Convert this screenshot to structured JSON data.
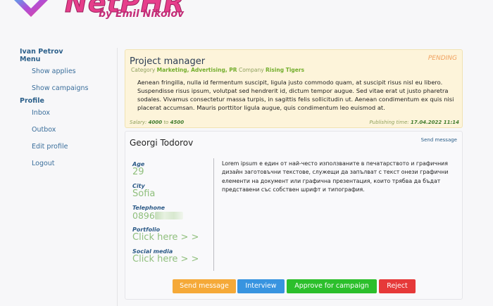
{
  "logo": {
    "text": "NetPHR",
    "subtitle": "by Emil Nikolov"
  },
  "sidebar": {
    "user": "Ivan Petrov",
    "menu_heading": "Menu",
    "menu_items": [
      "Show applies",
      "Show campaigns"
    ],
    "profile_heading": "Profile",
    "profile_items": [
      "Inbox",
      "Outbox",
      "Edit profile",
      "Logout"
    ]
  },
  "job": {
    "title": "Project manager",
    "status": "PENDING",
    "category_label": "Category",
    "categories": "Marketing, Advertising, PR",
    "company_label": "Company",
    "company": "Rising Tigers",
    "description": "Aenean fringilla, nulla id fermentum suscipit, ligula justo commodo quam, at suscipit risus nisl eu libero. Suspendisse risus ipsum, volutpat sed hendrerit id, dictum tempor augue. Sed vitae erat ut justo pharetra sodales. Vivamus consectetur massa turpis, in sagittis felis sollicitudin ut. Aenean condimentum ex quis nisi placerat accumsan. Mauris porttitor ligula augue, quis condimentum leo euismod at.",
    "salary_label": "Salary:",
    "salary_from": "4000",
    "salary_to_label": "to",
    "salary_to": "4500",
    "published_label": "Publishing time:",
    "published": "17.04.2022 11:14"
  },
  "applicant": {
    "name": "Georgi Todorov",
    "send_message_link": "Send message",
    "age_label": "Age",
    "age": "29",
    "city_label": "City",
    "city": "Sofia",
    "telephone_label": "Telephone",
    "telephone": "0896",
    "portfolio_label": "Portfolio",
    "portfolio": "Click here > >",
    "social_label": "Social media",
    "social": "Click here > >",
    "bio": "Lorem ipsum е един от най-често използваните в печатарството и графичния дизайн заготовъчни текстове, служещи да запълват с текст онези графични елементи на документ или графична презентация, които трябва да бъдат представени със собствен шрифт и типография."
  },
  "actions": {
    "send_message": "Send message",
    "interview": "Interview",
    "approve": "Approve for campaign",
    "reject": "Reject"
  },
  "colors": {
    "pending": "#f0a05e",
    "send_message": "#f5a938",
    "interview": "#3894e0",
    "approve": "#2cbf2c",
    "reject": "#e63939"
  }
}
